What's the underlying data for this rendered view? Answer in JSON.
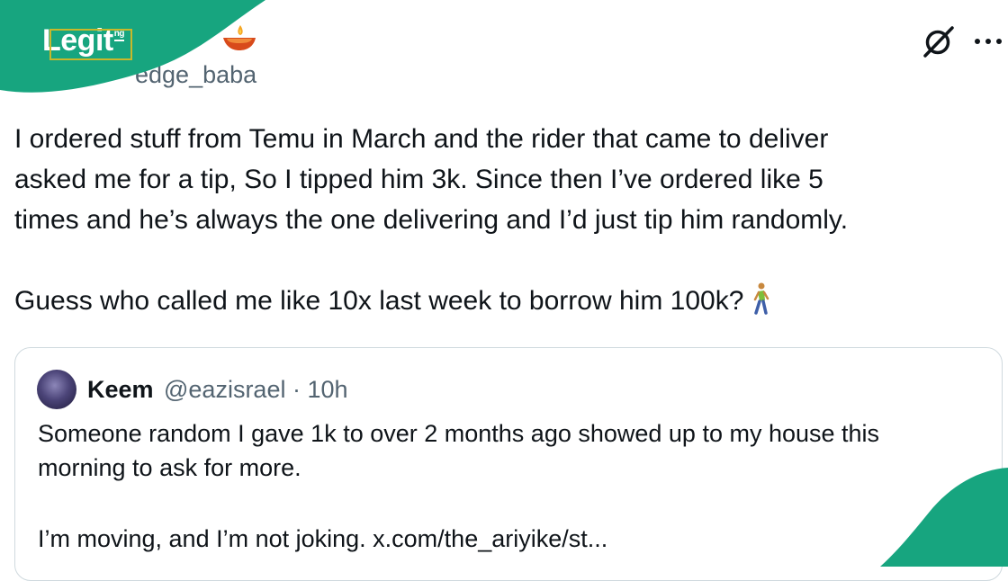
{
  "post": {
    "display_name": "a",
    "handle": "edge_baba",
    "lines": [
      "I ordered stuff from Temu in March and the rider that came to deliver",
      "asked me for a tip, So I tipped him 3k. Since then I’ve ordered like 5",
      "times and he’s always the one delivering and I’d just tip him randomly.",
      "Guess who called me like 10x last week to borrow him 100k?"
    ],
    "emoji_icon": "person-walking-icon"
  },
  "header_icons": [
    "grok-icon",
    "more-icon"
  ],
  "quoted": {
    "name": "Keem",
    "handle_time": "@eazisrael · 10h",
    "lines": [
      "Someone random I gave 1k to over 2 months ago showed up to my house this",
      "morning to ask for more.",
      "I’m moving, and I’m not joking. x.com/the_ariyike/st..."
    ]
  },
  "brand": {
    "logo": "Legit",
    "logo_suffix": "ng",
    "color": "#17a57f"
  }
}
